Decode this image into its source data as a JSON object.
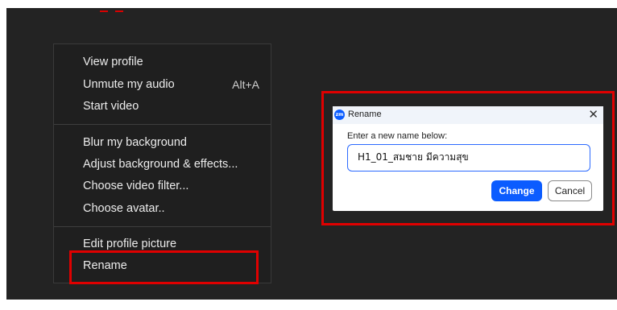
{
  "header_clip": "_ _          ",
  "menu": {
    "items": [
      {
        "label": "View profile"
      },
      {
        "label": "Unmute my audio",
        "shortcut": "Alt+A"
      },
      {
        "label": "Start video"
      },
      {
        "label": "Blur my background"
      },
      {
        "label": "Adjust background & effects..."
      },
      {
        "label": "Choose video filter..."
      },
      {
        "label": "Choose avatar.."
      },
      {
        "label": "Edit profile picture"
      },
      {
        "label": "Rename"
      }
    ]
  },
  "dialog": {
    "title": "Rename",
    "logo_text": "zm",
    "close_glyph": "✕",
    "prompt": "Enter a new name below:",
    "name_value": "H1_01_สมชาย มีความสุข",
    "change_label": "Change",
    "cancel_label": "Cancel"
  },
  "colors": {
    "highlight": "#e00000",
    "accent": "#0b5cff",
    "menu_bg": "#1f1f1f"
  }
}
